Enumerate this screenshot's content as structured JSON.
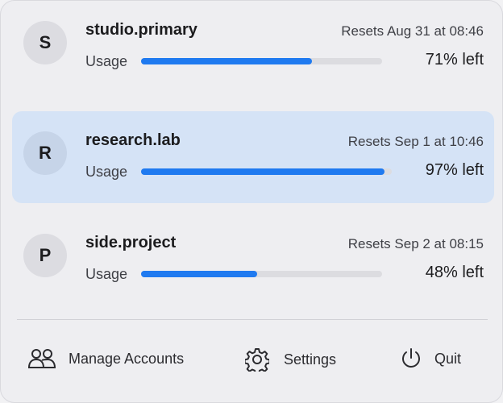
{
  "accounts": [
    {
      "initial": "S",
      "name": "studio.primary",
      "resets": "Resets Aug 31 at 08:46",
      "usage_label": "Usage",
      "usage_fraction": 0.71,
      "left": "71% left",
      "selected": false
    },
    {
      "initial": "R",
      "name": "research.lab",
      "resets": "Resets Sep 1 at 10:46",
      "usage_label": "Usage",
      "usage_fraction": 0.97,
      "left": "97% left",
      "selected": true
    },
    {
      "initial": "P",
      "name": "side.project",
      "resets": "Resets Sep 2 at 08:15",
      "usage_label": "Usage",
      "usage_fraction": 0.48,
      "left": "48% left",
      "selected": false
    }
  ],
  "footer": {
    "manage_label": "Manage Accounts",
    "manage_icon": "people-icon",
    "settings_label": "Settings",
    "settings_icon": "gear-icon",
    "quit_label": "Quit",
    "quit_icon": "power-icon"
  },
  "colors": {
    "accent": "#1f7af0",
    "selected_row": "#d5e3f6"
  }
}
